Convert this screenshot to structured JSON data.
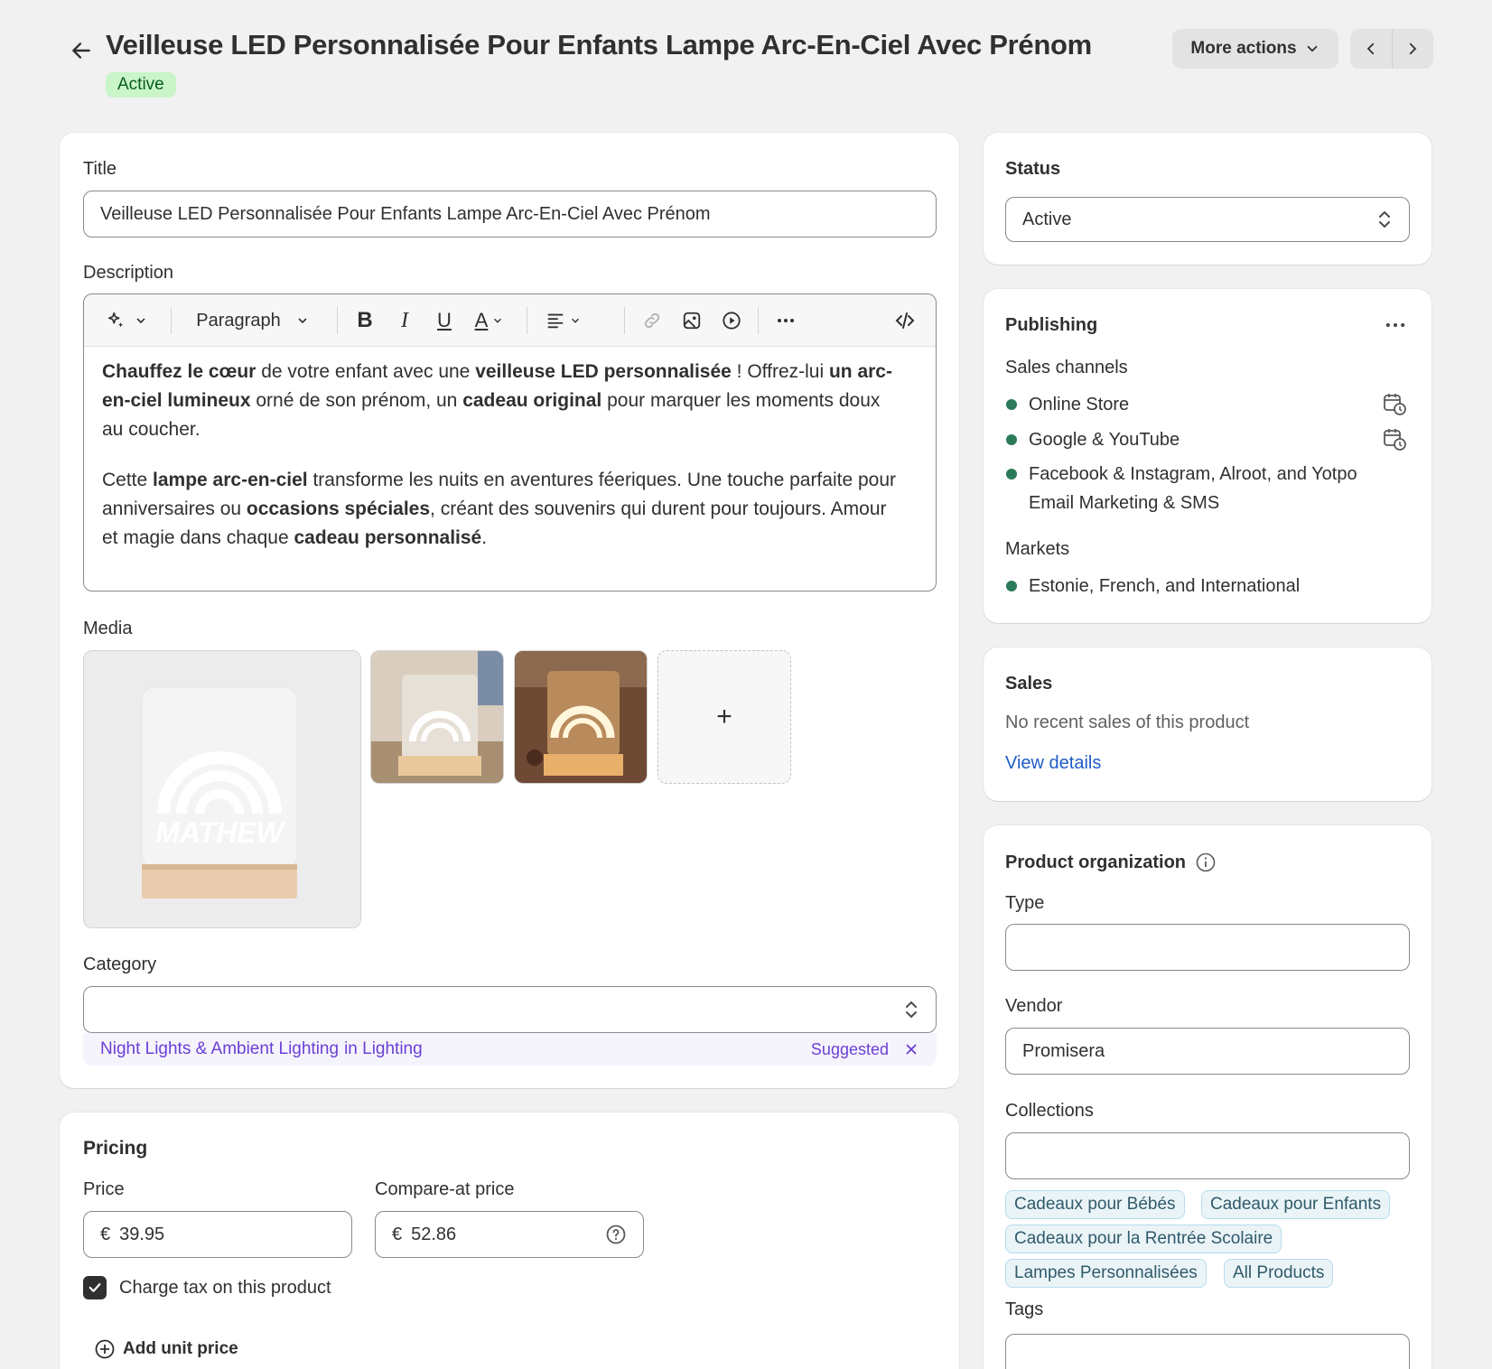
{
  "header": {
    "title": "Veilleuse LED Personnalisée Pour Enfants Lampe Arc-En-Ciel Avec Prénom",
    "status_badge": "Active",
    "more_actions": "More actions"
  },
  "main": {
    "title_label": "Title",
    "title_value": "Veilleuse LED Personnalisée Pour Enfants Lampe Arc-En-Ciel Avec Prénom",
    "description_label": "Description",
    "toolbar": {
      "paragraph": "Paragraph"
    },
    "description": {
      "p1": [
        {
          "t": "Chauffez le cœur",
          "b": true
        },
        {
          "t": " de votre enfant avec une ",
          "b": false
        },
        {
          "t": "veilleuse LED personnalisée",
          "b": true
        },
        {
          "t": " ! Offrez-lui ",
          "b": false
        },
        {
          "t": "un arc-en-ciel lumineux",
          "b": true
        },
        {
          "t": " orné de son prénom, un ",
          "b": false
        },
        {
          "t": "cadeau original",
          "b": true
        },
        {
          "t": " pour marquer les moments doux au coucher.",
          "b": false
        }
      ],
      "p2": [
        {
          "t": "Cette ",
          "b": false
        },
        {
          "t": "lampe arc-en-ciel",
          "b": true
        },
        {
          "t": " transforme les nuits en aventures féeriques. Une touche parfaite pour anniversaires ou ",
          "b": false
        },
        {
          "t": "occasions spéciales",
          "b": true
        },
        {
          "t": ", créant des souvenirs qui durent pour toujours. Amour et magie dans chaque ",
          "b": false
        },
        {
          "t": "cadeau personnalisé",
          "b": true
        },
        {
          "t": ".",
          "b": false
        }
      ]
    },
    "media_label": "Media",
    "media_main_text": "MATHEW",
    "media_add": "+",
    "category_label": "Category",
    "category_value": "",
    "category_suggestion": "Night Lights & Ambient Lighting",
    "category_suggestion_in": "in Lighting",
    "category_suggested": "Suggested"
  },
  "pricing": {
    "title": "Pricing",
    "price_label": "Price",
    "currency": "€",
    "price": "39.95",
    "compare_label": "Compare-at price",
    "compare_price": "52.86",
    "charge_tax": "Charge tax on this product",
    "add_unit_price": "Add unit price"
  },
  "status_card": {
    "title": "Status",
    "value": "Active"
  },
  "publishing": {
    "title": "Publishing",
    "sales_channels_label": "Sales channels",
    "channels": [
      "Online Store",
      "Google & YouTube",
      "Facebook & Instagram, Alroot, and Yotpo",
      "Email Marketing & SMS"
    ],
    "markets_label": "Markets",
    "markets": "Estonie, French, and International"
  },
  "sales": {
    "title": "Sales",
    "text": "No recent sales of this product",
    "link": "View details"
  },
  "organization": {
    "title": "Product organization",
    "type_label": "Type",
    "type_value": "",
    "vendor_label": "Vendor",
    "vendor_value": "Promisera",
    "collections_label": "Collections",
    "collections_value": "",
    "collections": [
      "Cadeaux pour Bébés",
      "Cadeaux pour Enfants",
      "Cadeaux pour la Rentrée Scolaire",
      "Lampes Personnalisées",
      "All Products"
    ],
    "tags_label": "Tags"
  },
  "colors": {
    "active_badge_bg": "#c9f5c9",
    "channel_dot": "#2c7a5a",
    "link": "#1f5cc8",
    "suggestion": "#6b3fd4"
  }
}
